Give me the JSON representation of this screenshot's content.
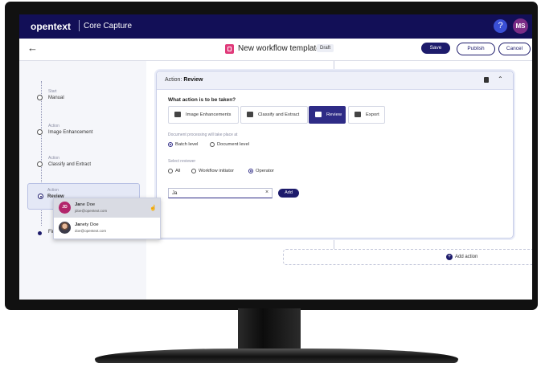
{
  "header": {
    "brand": "opentext",
    "product": "Core Capture",
    "help_label": "?",
    "user_initials": "MS"
  },
  "toolbar": {
    "back_label": "←",
    "template_title": "New workflow template",
    "status_badge": "Draft",
    "save_label": "Save",
    "publish_label": "Publish",
    "cancel_label": "Cancel"
  },
  "sidebar": {
    "steps": [
      {
        "label": "Start",
        "name": "Manual"
      },
      {
        "label": "Action",
        "name": "Image Enhancement"
      },
      {
        "label": "Action",
        "name": "Classify and Extract"
      },
      {
        "label": "Action",
        "name": "Review",
        "active": true
      },
      {
        "label": "",
        "name": "Finish"
      }
    ]
  },
  "panel": {
    "title_prefix": "Action:",
    "title_value": "Review",
    "question": "What action is to be taken?",
    "actions": [
      {
        "label": "Image Enhancements",
        "icon": "image-enhance-icon"
      },
      {
        "label": "Classify and Extract",
        "icon": "hierarchy-icon"
      },
      {
        "label": "Review",
        "icon": "review-icon",
        "selected": true
      },
      {
        "label": "Export",
        "icon": "export-icon"
      }
    ],
    "processing_hint": "Document processing will take place at",
    "processing_options": [
      {
        "label": "Batch level",
        "checked": true
      },
      {
        "label": "Document level",
        "checked": false
      }
    ],
    "reviewer_hint": "Select reviewer",
    "reviewer_options": [
      {
        "label": "All",
        "checked": false
      },
      {
        "label": "Workflow initiator",
        "checked": false
      },
      {
        "label": "Operator",
        "checked": true
      }
    ],
    "search_value": "Ja",
    "clear_label": "×",
    "add_label": "Add"
  },
  "dropdown": {
    "items": [
      {
        "initials": "JD",
        "name_match": "Ja",
        "name_rest": "ne Doe",
        "email": "jdoe@opentext.com"
      },
      {
        "initials": "",
        "name_match": "Ja",
        "name_rest": "nety Doe",
        "email": "doe@opentext.com"
      }
    ]
  },
  "add_action_label": "Add action",
  "colors": {
    "topbar": "#120f57",
    "accent": "#2e2b86",
    "avatar": "#7b2d86",
    "template_icon": "#e03a7a"
  }
}
